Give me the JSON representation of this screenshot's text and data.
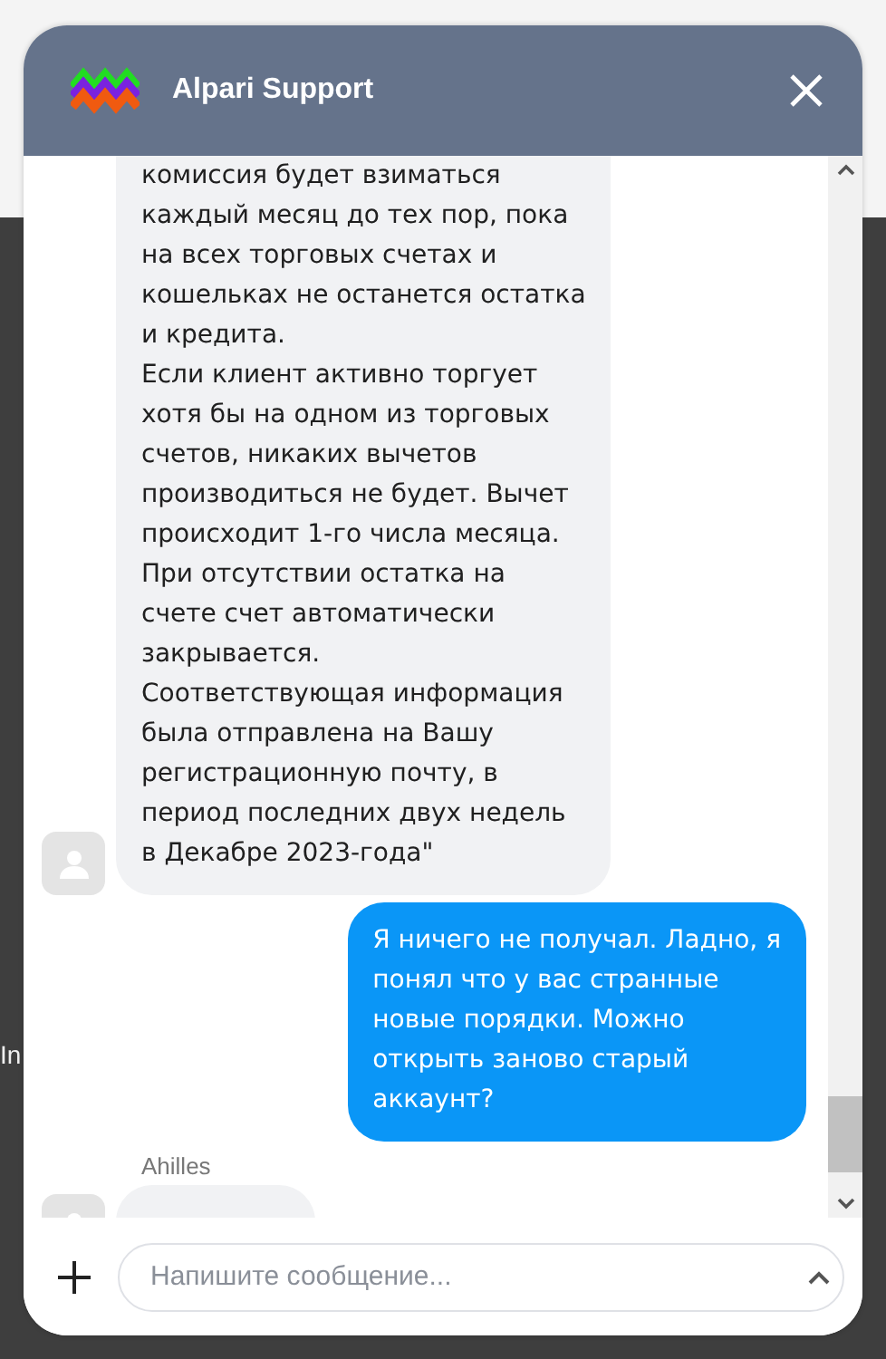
{
  "background_text": "In",
  "header": {
    "title": "Alpari Support"
  },
  "messages": [
    {
      "kind": "agent",
      "text": "комиссия будет взиматься\nкаждый месяц до тех пор, пока\nна всех торговых счетах и\nкошельках не останется остатка\nи кредита.\nЕсли клиент активно торгует\nхотя бы на одном из торговых\nсчетов, никаких вычетов\nпроизводиться не будет. Вычет\nпроисходит 1-го числа месяца.\nПри отсутствии остатка на\nсчете счет автоматически\nзакрывается.\nСоответствующая информация\nбыла отправлена на Вашу\nрегистрационную почту, в\nпериод последних двух недель\nв Декабре 2023-года\""
    },
    {
      "kind": "user",
      "text": "Я ничего не получал. Ладно, я\nпонял что у вас странные\nновые порядки. Можно\nоткрыть заново старый\nаккаунт?"
    },
    {
      "kind": "agent",
      "author": "Ahilles"
    }
  ],
  "composer": {
    "placeholder": "Напишите сообщение..."
  }
}
